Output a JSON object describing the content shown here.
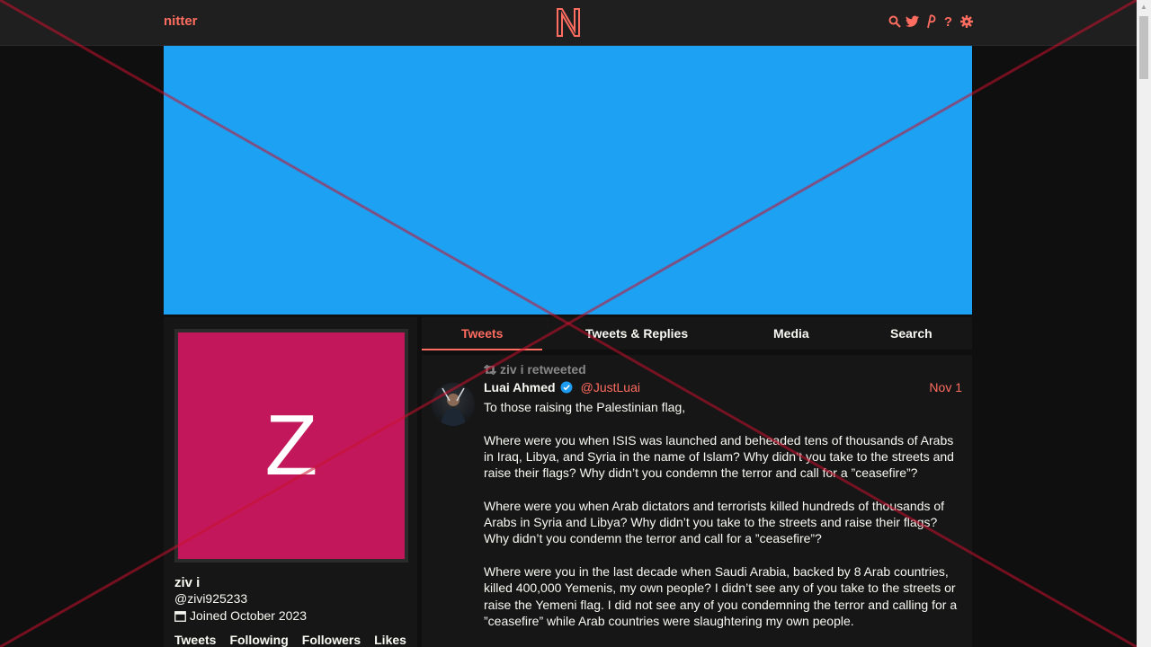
{
  "nav": {
    "brand": "nitter",
    "icons": [
      "search-icon",
      "twitter-icon",
      "rss-icon",
      "help-icon",
      "settings-icon"
    ],
    "help_glyph": "?"
  },
  "colors": {
    "accent": "#ff6c60",
    "banner": "#1da1f2",
    "avatar_bg": "#c2185b",
    "background": "#0f0f0f",
    "panel": "#161616"
  },
  "profile": {
    "avatar_letter": "Z",
    "fullname": "ziv i",
    "username": "@zivi925233",
    "joined": "Joined October 2023",
    "stats": [
      "Tweets",
      "Following",
      "Followers",
      "Likes"
    ]
  },
  "tabs": [
    {
      "label": "Tweets",
      "active": true
    },
    {
      "label": "Tweets & Replies",
      "active": false
    },
    {
      "label": "Media",
      "active": false
    },
    {
      "label": "Search",
      "active": false
    }
  ],
  "tweet": {
    "retweet_label": "ziv i retweeted",
    "author_name": "Luai Ahmed",
    "verified": true,
    "author_handle": "@JustLuai",
    "date": "Nov 1",
    "paragraphs": [
      "To those raising the Palestinian flag,",
      "Where were you when ISIS was launched and beheaded tens of thousands of Arabs in Iraq, Libya, and Syria in the name of Islam? Why didn’t you take to the streets and raise their flags? Why didn’t you condemn the terror and call for a ”ceasefire”?",
      "Where were you when Arab dictators and terrorists killed hundreds of thousands of Arabs in Syria and Libya? Why didn’t you take to the streets and raise their flags? Why didn’t you condemn the terror and call for a ”ceasefire”?",
      "Where were you in the last decade when Saudi Arabia, backed by 8 Arab countries, killed 400,000 Yemenis, my own people? I didn’t see any of you take to the streets or raise the Yemeni flag. I did not see any of you condemning the terror and calling for a ”ceasefire” while Arab countries were slaughtering my own people."
    ]
  }
}
